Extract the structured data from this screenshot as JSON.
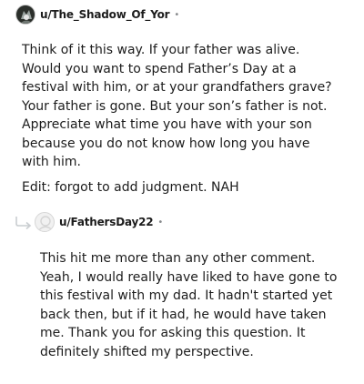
{
  "comments": [
    {
      "username": "u/The_Shadow_Of_Yor",
      "separator": "•",
      "avatar_icon": "dark-character-avatar-icon",
      "paragraphs": [
        "Think of it this way. If your father was alive. Would you want to spend Father’s Day at a festival with him, or at your grandfathers grave? Your father is gone. But your son’s father is not. Appreciate what time you have with your son because you do not know how long you have with him.",
        "Edit: forgot to add judgment. NAH"
      ]
    },
    {
      "username": "u/FathersDay22",
      "separator": "•",
      "avatar_icon": "default-user-avatar-icon",
      "reply_icon": "reply-arrow-icon",
      "paragraphs": [
        "This hit me more than any other comment. Yeah, I would really have liked to have gone to this festival with my dad. It hadn't started yet back then, but if it had, he would have taken me. Thank you for asking this question. It definitely shifted my perspective."
      ]
    }
  ],
  "colors": {
    "text": "#1c1c1c",
    "meta": "#878a8c",
    "reply_arrow": "#c9cdd0"
  }
}
